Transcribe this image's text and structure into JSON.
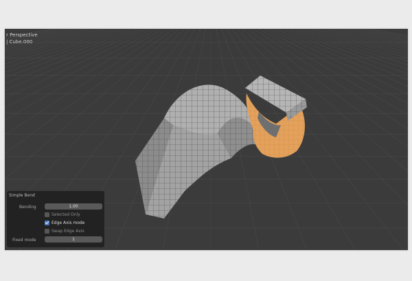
{
  "viewport": {
    "view_label": "r Perspective",
    "object_label": "| Cube.000"
  },
  "panel": {
    "title": "Simple Bend",
    "bending_label": "Bending",
    "bending_value": "1.00",
    "selected_only_label": "Selected Only",
    "selected_only_checked": false,
    "edge_axis_label": "Edge Axis mode",
    "edge_axis_checked": true,
    "swap_edge_label": "Swap Edge Axis",
    "swap_edge_checked": false,
    "fixed_mode_label": "Fixed mode",
    "fixed_mode_value": "1"
  },
  "colors": {
    "viewport_bg": "#3b3b3b",
    "mesh_face": "#9a9a9a",
    "mesh_selected": "#e4a35f",
    "panel_bg": "#222222",
    "checkbox_on": "#4a78c2"
  }
}
